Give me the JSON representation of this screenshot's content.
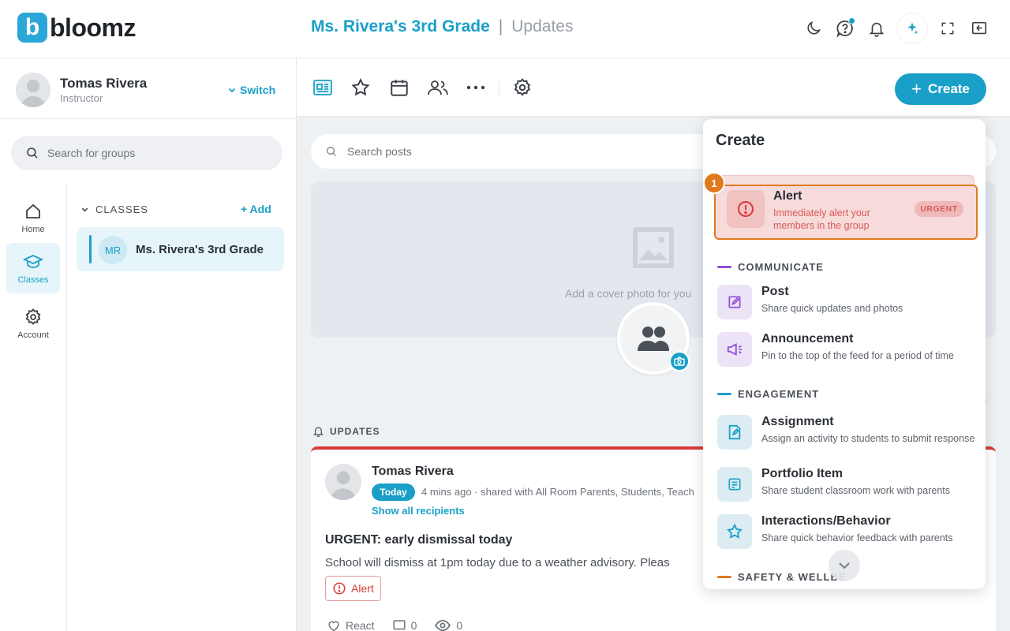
{
  "brand": {
    "logo_letter": "b",
    "name": "bloomz",
    "color": "#2aa7d6"
  },
  "header": {
    "group_name": "Ms. Rivera's 3rd Grade",
    "separator": "|",
    "page_name": "Updates"
  },
  "top_icons": [
    "moon-icon",
    "help-icon",
    "bell-icon",
    "sparkle-icon",
    "fullscreen-icon",
    "collapse-panel-icon"
  ],
  "profile": {
    "name": "Tomas Rivera",
    "role": "Instructor",
    "switch_label": "Switch"
  },
  "sidebar": {
    "search_placeholder": "Search for groups",
    "rail": [
      {
        "label": "Home",
        "icon": "home-icon"
      },
      {
        "label": "Classes",
        "icon": "graduation-cap-icon",
        "active": true
      },
      {
        "label": "Account",
        "icon": "gear-icon"
      }
    ],
    "classes_heading": "CLASSES",
    "add_label": "Add",
    "classes": [
      {
        "initials": "MR",
        "name": "Ms. Rivera's 3rd Grade"
      }
    ]
  },
  "toolbar": {
    "tools": [
      "feed-icon",
      "star-icon",
      "calendar-icon",
      "people-icon",
      "more-icon",
      "settings-icon"
    ],
    "create_label": "Create"
  },
  "main": {
    "search_placeholder": "Search posts",
    "cover_text": "Add a cover photo for you",
    "updates_heading": "UPDATES",
    "right_link": "t"
  },
  "post": {
    "author": "Tomas Rivera",
    "date_pill": "Today",
    "meta": "4 mins ago · shared with All Room Parents, Students, Teach",
    "show_all": "Show all recipients",
    "title": "URGENT: early dismissal today",
    "body": "School will dismiss at 1pm today due to a weather advisory. Pleas",
    "tag": "Alert",
    "react_label": "React",
    "comments_count": "0",
    "views_count": "0"
  },
  "create_menu": {
    "title": "Create",
    "step_number": "1",
    "alert": {
      "name": "Alert",
      "description": "Immediately alert your members in the group",
      "badge": "URGENT"
    },
    "sections": [
      {
        "heading": "COMMUNICATE",
        "color": "#8e4fd6",
        "items": [
          {
            "name": "Post",
            "description": "Share quick updates and photos"
          },
          {
            "name": "Announcement",
            "description": "Pin to the top of the feed for a period of time"
          }
        ]
      },
      {
        "heading": "ENGAGEMENT",
        "color": "#1aa0c8",
        "items": [
          {
            "name": "Assignment",
            "description": "Assign an activity to students to submit response"
          },
          {
            "name": "Portfolio Item",
            "description": "Share student classroom work with parents"
          },
          {
            "name": "Interactions/Behavior",
            "description": "Share quick behavior feedback with parents"
          }
        ]
      },
      {
        "heading": "SAFETY & WELLBE",
        "color": "#e07a1f",
        "items": []
      }
    ]
  },
  "colors": {
    "accent": "#1aa0c8",
    "alert_red": "#d83a3a",
    "highlight_orange": "#e07a1f"
  }
}
